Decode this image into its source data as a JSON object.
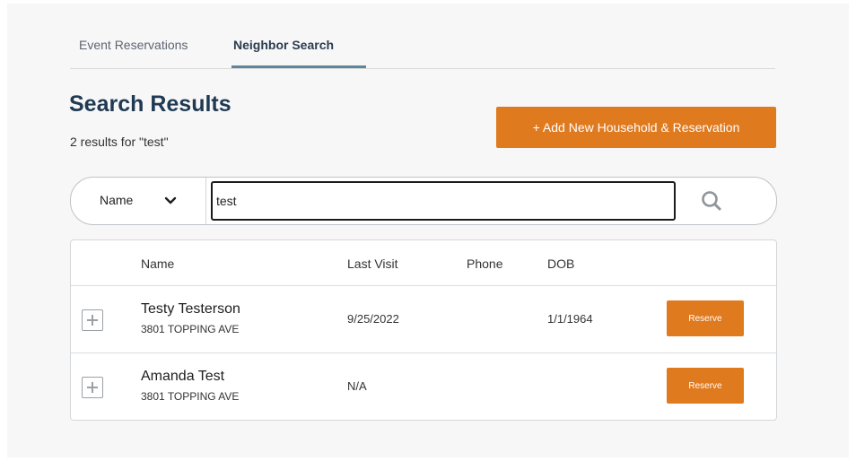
{
  "tabs": [
    {
      "label": "Event Reservations",
      "active": false
    },
    {
      "label": "Neighbor Search",
      "active": true
    }
  ],
  "header": {
    "title": "Search Results",
    "count": "2 results for \"test\""
  },
  "actions": {
    "add_household": "+ Add New Household & Reservation"
  },
  "search": {
    "field_selected": "Name",
    "query": "test",
    "icon": "search-icon"
  },
  "table": {
    "columns": [
      "Name",
      "Last Visit",
      "Phone",
      "DOB"
    ],
    "rows": [
      {
        "name": "Testy Testerson",
        "address": "3801 TOPPING AVE",
        "last_visit": "9/25/2022",
        "phone": "",
        "dob": "1/1/1964",
        "action": "Reserve"
      },
      {
        "name": "Amanda Test",
        "address": "3801 TOPPING AVE",
        "last_visit": "N/A",
        "phone": "",
        "dob": "",
        "action": "Reserve"
      }
    ]
  },
  "colors": {
    "accent": "#e07a1f",
    "title": "#1f3a52",
    "tab_underline": "#5f8698"
  }
}
